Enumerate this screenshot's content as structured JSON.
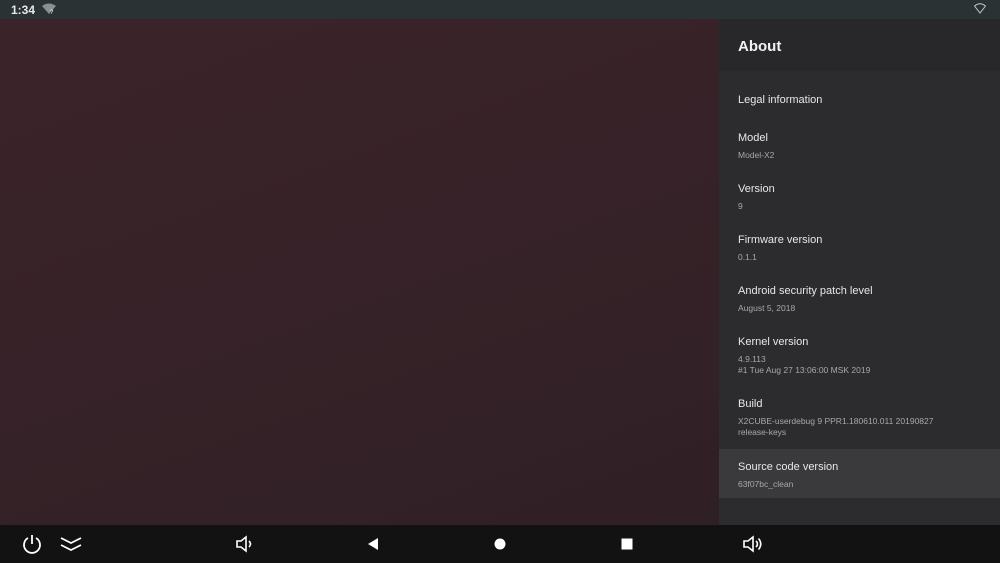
{
  "status_bar": {
    "time": "1:34",
    "icons": [
      "wifi-unknown-icon",
      "wifi-icon"
    ]
  },
  "about": {
    "title": "About",
    "items": [
      {
        "title": "Legal information",
        "lines": []
      },
      {
        "title": "Model",
        "lines": [
          "Model-X2"
        ]
      },
      {
        "title": "Version",
        "lines": [
          "9"
        ]
      },
      {
        "title": "Firmware version",
        "lines": [
          "0.1.1"
        ]
      },
      {
        "title": "Android security patch level",
        "lines": [
          "August 5, 2018"
        ]
      },
      {
        "title": "Kernel version",
        "lines": [
          "4.9.113",
          "#1 Tue Aug 27 13:06:00 MSK 2019"
        ]
      },
      {
        "title": "Build",
        "lines": [
          "X2CUBE-userdebug 9 PPR1.180610.011 20190827",
          "release-keys"
        ]
      },
      {
        "title": "Source code version",
        "lines": [
          "63f07bc_clean"
        ],
        "selected": true
      }
    ]
  },
  "nav_bar": {
    "buttons": [
      "power-icon",
      "collapse-icon",
      "volume-down-icon",
      "back-icon",
      "home-icon",
      "recents-icon",
      "volume-up-icon"
    ]
  }
}
